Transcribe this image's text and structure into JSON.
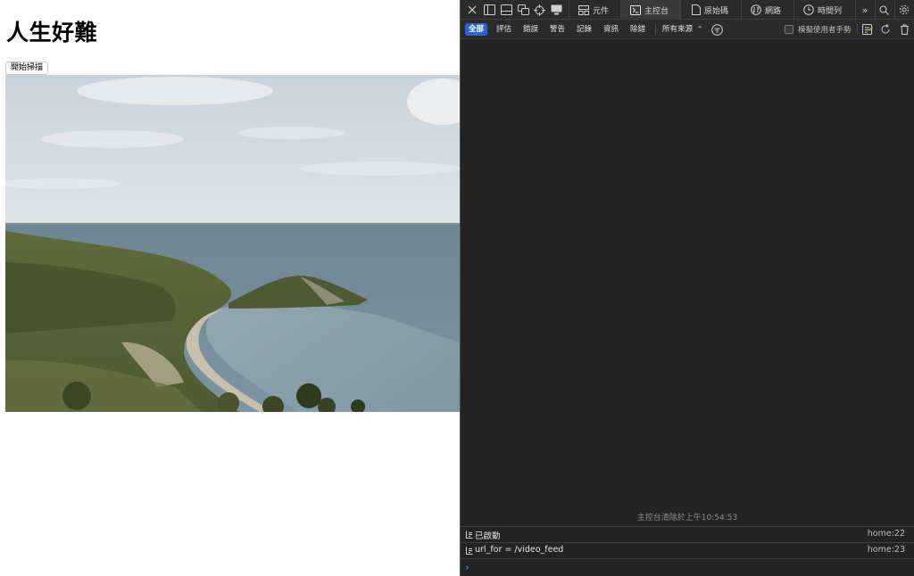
{
  "page": {
    "title": "人生好難",
    "scan_button": "開始掃描",
    "image_alt": "coastal cliffs and bay"
  },
  "devtools": {
    "tabs": [
      {
        "label": "元件",
        "icon": "elements-icon"
      },
      {
        "label": "主控台",
        "icon": "console-icon"
      },
      {
        "label": "原始碼",
        "icon": "sources-icon"
      },
      {
        "label": "網路",
        "icon": "network-icon"
      },
      {
        "label": "時間列",
        "icon": "timelines-icon"
      }
    ],
    "active_tab": "主控台",
    "filters": [
      "全部",
      "評估",
      "錯誤",
      "警告",
      "記錄",
      "資訊",
      "除錯"
    ],
    "active_filter": "全部",
    "sources_select": "所有來源",
    "touch_toggle_label": "模擬使用者手勢",
    "cleared_message": "主控台清除於上午10:54:53",
    "logs": [
      {
        "text": "已啟動",
        "source": "home:22"
      },
      {
        "text": "url_for = /video_feed",
        "source": "home:23"
      }
    ],
    "colors": {
      "background": "#232323",
      "toolbar": "#2b2b2b",
      "accent": "#2e62d1",
      "prompt": "#3b82f6"
    }
  }
}
